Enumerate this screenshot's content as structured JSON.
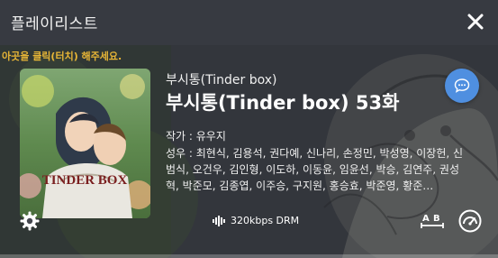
{
  "header": {
    "title": "플레이리스트"
  },
  "player": {
    "hint": "아곳을 클릭(터치) 해주세요.",
    "cover_alt": "Tinder Box",
    "cover_text": "TINDER BOX",
    "series_title": "부시통(Tinder box)",
    "episode_title": "부시통(Tinder box) 53화",
    "author_line": "작가 : 유우지",
    "cast_line": "성우 : 최현식, 김용석, 권다예, 신나리, 손정민, 박성영, 이장헌, 신범식, 오건우, 김인형, 이도하, 이동윤, 임윤선, 박승, 김연주, 권성혁, 박준모, 김종엽, 이주승, 구지원, 홍승효, 박준영, 황준…",
    "quality": "320kbps DRM",
    "progress": 0
  },
  "colors": {
    "accent": "#4f8fe0",
    "hint": "#e8b636",
    "header_bg": "#373a41"
  },
  "icons": {
    "close": "close-icon",
    "chat": "chat-bubble-icon",
    "settings": "gear-icon",
    "audio": "audio-wave-icon",
    "ab_repeat": "ab-repeat-icon",
    "speed": "speed-gauge-icon"
  }
}
